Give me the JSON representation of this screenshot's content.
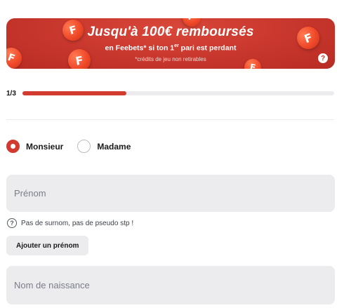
{
  "banner": {
    "title": "Jusqu'à 100€ remboursés",
    "subtitle_before": "en Feebets* si ton 1",
    "subtitle_sup": "er",
    "subtitle_after": " pari est perdant",
    "note": "*crédits de jeu non retirables",
    "help_glyph": "?",
    "coin_letter": "F",
    "colors": {
      "background": "#c7362c",
      "coin": "#f04a2a"
    }
  },
  "progress": {
    "label": "1/3",
    "current_step": 1,
    "total_steps": 3,
    "fill_fraction": 0.333,
    "accent_color": "#d23b30"
  },
  "gender": {
    "options": [
      {
        "label": "Monsieur",
        "selected": true
      },
      {
        "label": "Madame",
        "selected": false
      }
    ]
  },
  "form": {
    "first_name": {
      "placeholder": "Prénom",
      "value": ""
    },
    "hint": {
      "icon": "question-circle-icon",
      "glyph": "?",
      "text": "Pas de surnom, pas de pseudo stp !"
    },
    "add_first_name_label": "Ajouter un prénom",
    "last_name": {
      "placeholder": "Nom de naissance",
      "value": ""
    }
  }
}
